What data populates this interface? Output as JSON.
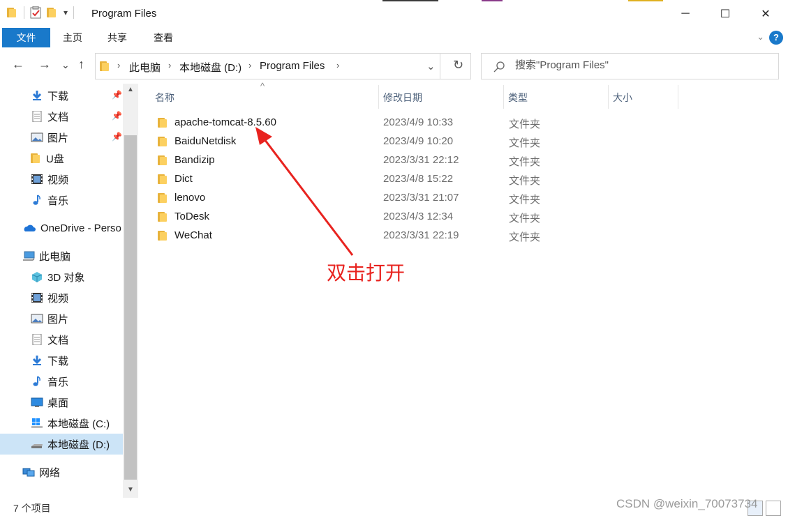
{
  "window": {
    "title": "Program Files",
    "minimize": "─",
    "maximize": "☐",
    "close": "✕",
    "qa_dropdown": "▾"
  },
  "ribbon": {
    "tabs": [
      "文件",
      "主页",
      "共享",
      "查看"
    ],
    "help": "?",
    "collapse": "⌄",
    "accent": "#1979ca"
  },
  "nav": {
    "back": "←",
    "forward": "→",
    "recent": "⌄",
    "up": "↑",
    "breadcrumb": [
      "此电脑",
      "本地磁盘 (D:)",
      "Program Files"
    ],
    "refresh": "↻",
    "dropdown": "⌄",
    "search_placeholder": "搜索\"Program Files\""
  },
  "sidebar": {
    "quick_access": [
      {
        "label": "下载",
        "icon": "download-icon",
        "pinned": true
      },
      {
        "label": "文档",
        "icon": "document-icon",
        "pinned": true
      },
      {
        "label": "图片",
        "icon": "picture-icon",
        "pinned": true
      },
      {
        "label": "U盘",
        "icon": "folder-icon",
        "pinned": false
      },
      {
        "label": "视频",
        "icon": "video-icon",
        "pinned": false
      },
      {
        "label": "音乐",
        "icon": "music-icon",
        "pinned": false
      }
    ],
    "onedrive": "OneDrive - Perso",
    "this_pc": "此电脑",
    "pc_items": [
      {
        "label": "3D 对象",
        "icon": "3d-objects-icon"
      },
      {
        "label": "视频",
        "icon": "video-icon"
      },
      {
        "label": "图片",
        "icon": "picture-icon"
      },
      {
        "label": "文档",
        "icon": "document-icon"
      },
      {
        "label": "下载",
        "icon": "download-icon"
      },
      {
        "label": "音乐",
        "icon": "music-icon"
      },
      {
        "label": "桌面",
        "icon": "desktop-icon"
      },
      {
        "label": "本地磁盘 (C:)",
        "icon": "windows-drive-icon"
      },
      {
        "label": "本地磁盘 (D:)",
        "icon": "drive-icon",
        "selected": true
      }
    ],
    "network": "网络",
    "scroll_up": "▲",
    "scroll_down": "▼"
  },
  "list": {
    "columns": [
      "名称",
      "修改日期",
      "类型",
      "大小"
    ],
    "sort_indicator": "^",
    "rows": [
      {
        "name": "apache-tomcat-8.5.60",
        "date": "2023/4/9 10:33",
        "type": "文件夹"
      },
      {
        "name": "BaiduNetdisk",
        "date": "2023/4/9 10:20",
        "type": "文件夹"
      },
      {
        "name": "Bandizip",
        "date": "2023/3/31 22:12",
        "type": "文件夹"
      },
      {
        "name": "Dict",
        "date": "2023/4/8 15:22",
        "type": "文件夹"
      },
      {
        "name": "lenovo",
        "date": "2023/3/31 21:07",
        "type": "文件夹"
      },
      {
        "name": "ToDesk",
        "date": "2023/4/3 12:34",
        "type": "文件夹"
      },
      {
        "name": "WeChat",
        "date": "2023/3/31 22:19",
        "type": "文件夹"
      }
    ]
  },
  "annotation": {
    "text": "双击打开",
    "color": "#e8231f"
  },
  "status": {
    "count": "7 个项目",
    "watermark": "CSDN @weixin_70073734"
  }
}
